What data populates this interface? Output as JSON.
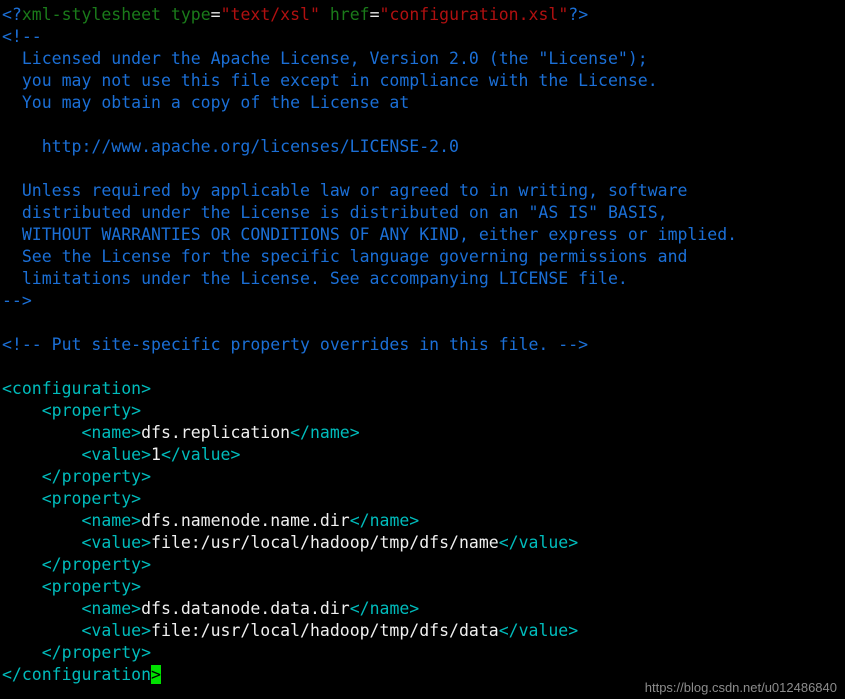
{
  "window": {
    "background_color": "#000000",
    "kind": "terminal-text-editor",
    "file_type": "xml"
  },
  "colors": {
    "processing_instruction": "#1b6fd6",
    "declaration_name": "#1a7a1a",
    "equals": "#e8e8e8",
    "attribute_string": "#b01010",
    "comment": "#1b6fd6",
    "tag": "#00bcbc",
    "content_text": "#f0f0f0",
    "cursor_background": "#00e000",
    "cursor_foreground": "#000000",
    "watermark": "#8c8c8c"
  },
  "code": {
    "lines": [
      {
        "id": "l1",
        "segments": [
          {
            "cls": "t-pi",
            "text": "<?"
          },
          {
            "cls": "t-decl",
            "text": "xml-stylesheet"
          },
          {
            "cls": "t-text",
            "text": " "
          },
          {
            "cls": "t-decl",
            "text": "type"
          },
          {
            "cls": "t-eq",
            "text": "="
          },
          {
            "cls": "t-str",
            "text": "\"text/xsl\""
          },
          {
            "cls": "t-text",
            "text": " "
          },
          {
            "cls": "t-decl",
            "text": "href"
          },
          {
            "cls": "t-eq",
            "text": "="
          },
          {
            "cls": "t-str",
            "text": "\"configuration.xsl\""
          },
          {
            "cls": "t-pi",
            "text": "?>"
          }
        ]
      },
      {
        "id": "l2",
        "segments": [
          {
            "cls": "t-comment",
            "text": "<!--"
          }
        ]
      },
      {
        "id": "l3",
        "segments": [
          {
            "cls": "t-comment",
            "text": "  Licensed under the Apache License, Version 2.0 (the \"License\");"
          }
        ]
      },
      {
        "id": "l4",
        "segments": [
          {
            "cls": "t-comment",
            "text": "  you may not use this file except in compliance with the License."
          }
        ]
      },
      {
        "id": "l5",
        "segments": [
          {
            "cls": "t-comment",
            "text": "  You may obtain a copy of the License at"
          }
        ]
      },
      {
        "id": "l6",
        "segments": [
          {
            "cls": "t-comment",
            "text": ""
          }
        ]
      },
      {
        "id": "l7",
        "segments": [
          {
            "cls": "t-comment",
            "text": "    http://www.apache.org/licenses/LICENSE-2.0"
          }
        ]
      },
      {
        "id": "l8",
        "segments": [
          {
            "cls": "t-comment",
            "text": ""
          }
        ]
      },
      {
        "id": "l9",
        "segments": [
          {
            "cls": "t-comment",
            "text": "  Unless required by applicable law or agreed to in writing, software"
          }
        ]
      },
      {
        "id": "l10",
        "segments": [
          {
            "cls": "t-comment",
            "text": "  distributed under the License is distributed on an \"AS IS\" BASIS,"
          }
        ]
      },
      {
        "id": "l11",
        "segments": [
          {
            "cls": "t-comment",
            "text": "  WITHOUT WARRANTIES OR CONDITIONS OF ANY KIND, either express or implied."
          }
        ]
      },
      {
        "id": "l12",
        "segments": [
          {
            "cls": "t-comment",
            "text": "  See the License for the specific language governing permissions and"
          }
        ]
      },
      {
        "id": "l13",
        "segments": [
          {
            "cls": "t-comment",
            "text": "  limitations under the License. See accompanying LICENSE file."
          }
        ]
      },
      {
        "id": "l14",
        "segments": [
          {
            "cls": "t-comment",
            "text": "-->"
          }
        ]
      },
      {
        "id": "l15",
        "segments": [
          {
            "cls": "t-text",
            "text": ""
          }
        ]
      },
      {
        "id": "l16",
        "segments": [
          {
            "cls": "t-comment",
            "text": "<!-- Put site-specific property overrides in this file. -->"
          }
        ]
      },
      {
        "id": "l17",
        "segments": [
          {
            "cls": "t-text",
            "text": ""
          }
        ]
      },
      {
        "id": "l18",
        "segments": [
          {
            "cls": "t-tag",
            "text": "<configuration>"
          }
        ]
      },
      {
        "id": "l19",
        "segments": [
          {
            "cls": "t-tag",
            "text": "    <property>"
          }
        ]
      },
      {
        "id": "l20",
        "segments": [
          {
            "cls": "t-tag",
            "text": "        <name>"
          },
          {
            "cls": "t-text",
            "text": "dfs.replication"
          },
          {
            "cls": "t-tag",
            "text": "</name>"
          }
        ]
      },
      {
        "id": "l21",
        "segments": [
          {
            "cls": "t-tag",
            "text": "        <value>"
          },
          {
            "cls": "t-text",
            "text": "1"
          },
          {
            "cls": "t-tag",
            "text": "</value>"
          }
        ]
      },
      {
        "id": "l22",
        "segments": [
          {
            "cls": "t-tag",
            "text": "    </property>"
          }
        ]
      },
      {
        "id": "l23",
        "segments": [
          {
            "cls": "t-tag",
            "text": "    <property>"
          }
        ]
      },
      {
        "id": "l24",
        "segments": [
          {
            "cls": "t-tag",
            "text": "        <name>"
          },
          {
            "cls": "t-text",
            "text": "dfs.namenode.name.dir"
          },
          {
            "cls": "t-tag",
            "text": "</name>"
          }
        ]
      },
      {
        "id": "l25",
        "segments": [
          {
            "cls": "t-tag",
            "text": "        <value>"
          },
          {
            "cls": "t-text",
            "text": "file:/usr/local/hadoop/tmp/dfs/name"
          },
          {
            "cls": "t-tag",
            "text": "</value>"
          }
        ]
      },
      {
        "id": "l26",
        "segments": [
          {
            "cls": "t-tag",
            "text": "    </property>"
          }
        ]
      },
      {
        "id": "l27",
        "segments": [
          {
            "cls": "t-tag",
            "text": "    <property>"
          }
        ]
      },
      {
        "id": "l28",
        "segments": [
          {
            "cls": "t-tag",
            "text": "        <name>"
          },
          {
            "cls": "t-text",
            "text": "dfs.datanode.data.dir"
          },
          {
            "cls": "t-tag",
            "text": "</name>"
          }
        ]
      },
      {
        "id": "l29",
        "segments": [
          {
            "cls": "t-tag",
            "text": "        <value>"
          },
          {
            "cls": "t-text",
            "text": "file:/usr/local/hadoop/tmp/dfs/data"
          },
          {
            "cls": "t-tag",
            "text": "</value>"
          }
        ]
      },
      {
        "id": "l30",
        "segments": [
          {
            "cls": "t-tag",
            "text": "    </property>"
          }
        ]
      },
      {
        "id": "l31",
        "segments": [
          {
            "cls": "t-tag",
            "text": "</configuration"
          },
          {
            "cls": "cursor",
            "text": ">"
          }
        ]
      }
    ]
  },
  "watermark": {
    "text": "https://blog.csdn.net/u012486840"
  }
}
